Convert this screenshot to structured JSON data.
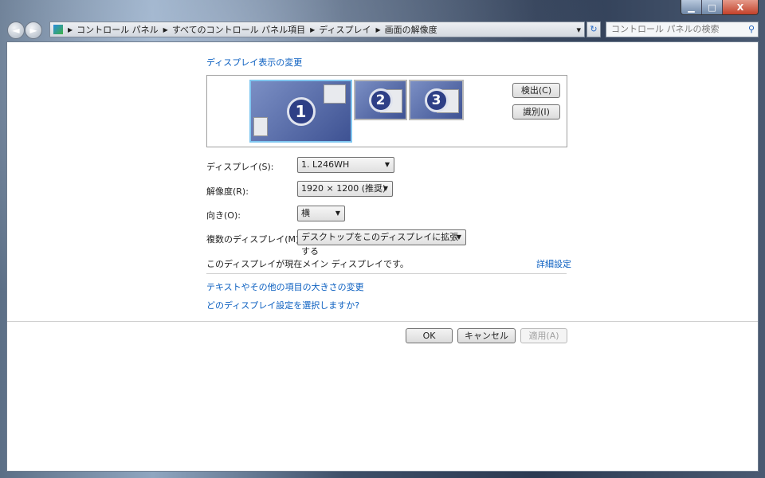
{
  "window": {
    "min_label": "▁",
    "max_label": "□",
    "close_label": "X"
  },
  "nav": {
    "back_icon": "◄",
    "forward_icon": "►"
  },
  "address": {
    "breadcrumb": [
      "コントロール パネル",
      "すべてのコントロール パネル項目",
      "ディスプレイ",
      "画面の解像度"
    ],
    "dropdown_icon": "▾",
    "refresh_icon": "↻"
  },
  "search": {
    "placeholder": "コントロール パネルの検索",
    "icon": "⚲"
  },
  "main": {
    "title": "ディスプレイ表示の変更",
    "monitors": [
      "1",
      "2",
      "3"
    ],
    "detect_label": "検出(C)",
    "identify_label": "識別(I)",
    "fields": {
      "display": {
        "label": "ディスプレイ(S):",
        "value": "1. L246WH"
      },
      "resolution": {
        "label": "解像度(R):",
        "value": "1920 × 1200 (推奨)"
      },
      "orientation": {
        "label": "向き(O):",
        "value": "横"
      },
      "multiple": {
        "label": "複数のディスプレイ(M):",
        "value": "デスクトップをこのディスプレイに拡張する"
      }
    },
    "status": "このディスプレイが現在メイン ディスプレイです。",
    "advanced_link": "詳細設定",
    "links": [
      "テキストやその他の項目の大きさの変更",
      "どのディスプレイ設定を選択しますか?"
    ],
    "ok_label": "OK",
    "cancel_label": "キャンセル",
    "apply_label": "適用(A)"
  }
}
